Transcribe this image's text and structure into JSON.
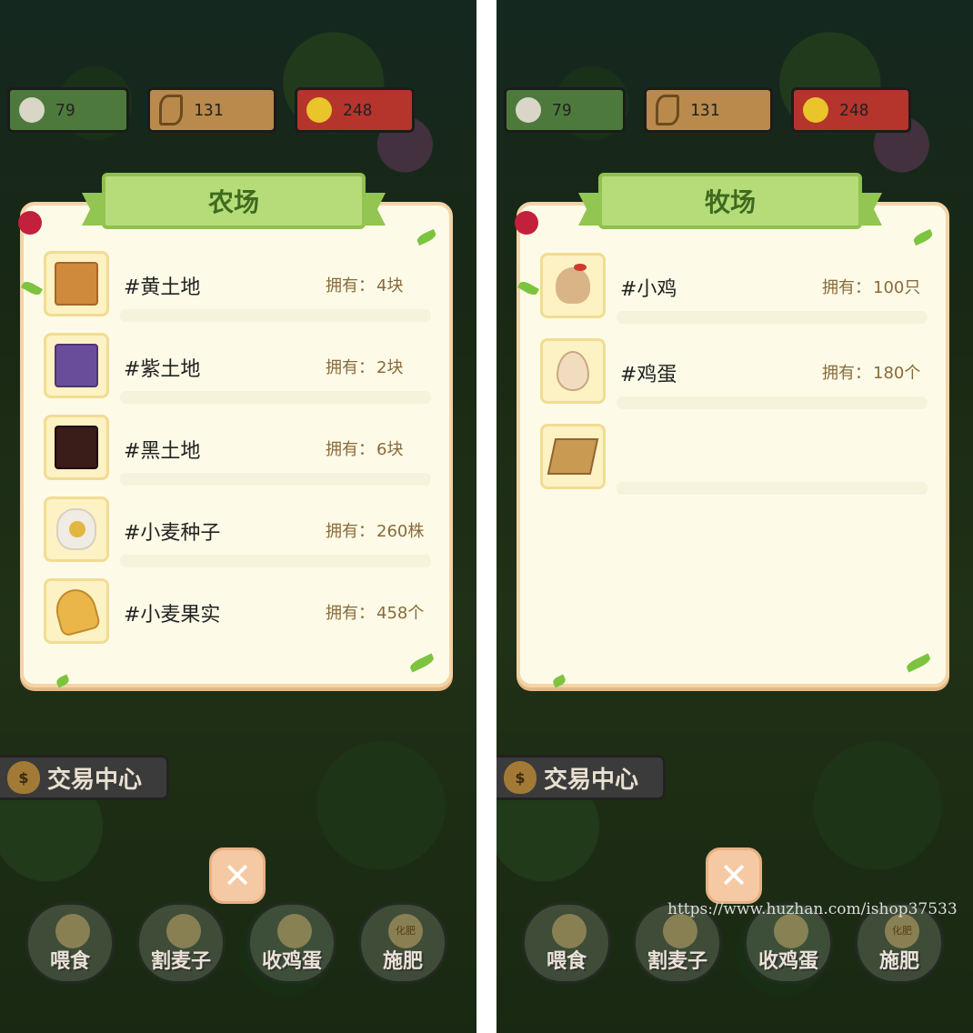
{
  "hud": {
    "eggs": "79",
    "wheat": "131",
    "coins": "248"
  },
  "trade_center": {
    "label": "交易中心"
  },
  "close_symbol": "✕",
  "actions": [
    "喂食",
    "割麦子",
    "收鸡蛋",
    "施肥"
  ],
  "fertilizer_bag_text": "化肥",
  "owned_label": "拥有：",
  "left_panel": {
    "title": "农场",
    "items": [
      {
        "icon": "yellow-soil-icon",
        "name": "#黄土地",
        "qty": "4块"
      },
      {
        "icon": "purple-soil-icon",
        "name": "#紫土地",
        "qty": "2块"
      },
      {
        "icon": "black-soil-icon",
        "name": "#黑土地",
        "qty": "6块"
      },
      {
        "icon": "wheat-seed-bag-icon",
        "name": "#小麦种子",
        "qty": "260株"
      },
      {
        "icon": "wheat-grain-icon",
        "name": "#小麦果实",
        "qty": "458个"
      }
    ]
  },
  "right_panel": {
    "title": "牧场",
    "items": [
      {
        "icon": "chicken-icon",
        "name": "#小鸡",
        "qty": "100只"
      },
      {
        "icon": "egg-icon",
        "name": "#鸡蛋",
        "qty": "180个"
      },
      {
        "icon": "sign-post-icon",
        "name": "",
        "qty": ""
      }
    ]
  },
  "watermark": "https://www.huzhan.com/ishop37533",
  "colors": {
    "panel_bg": "#fdfbe7",
    "ribbon": "#b6dc7a",
    "title_text": "#3e6b1f",
    "owned_text": "#8a6a3a"
  }
}
